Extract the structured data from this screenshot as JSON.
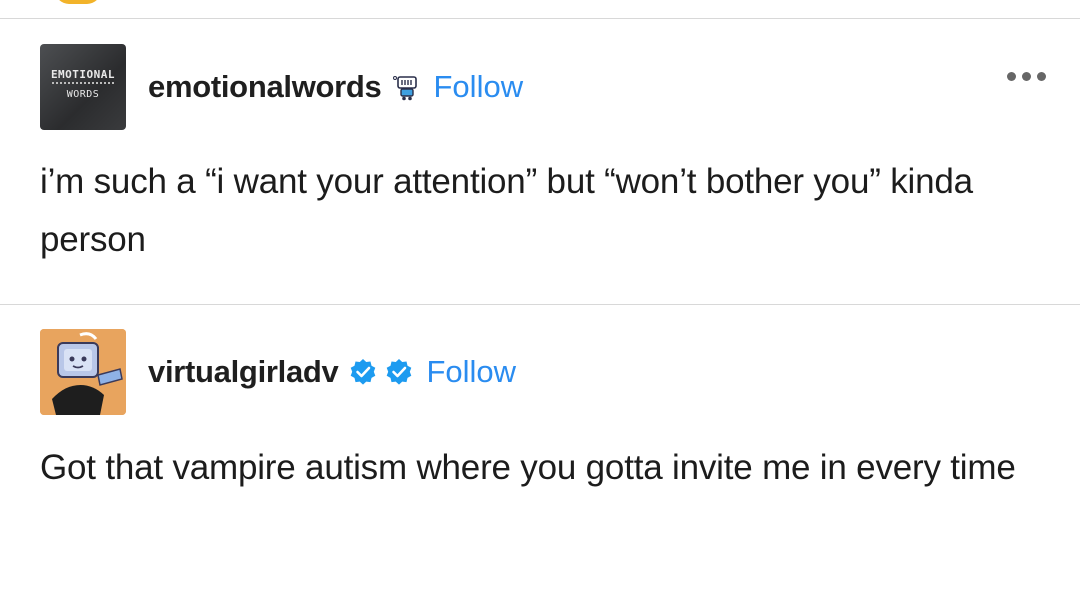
{
  "posts": [
    {
      "avatar": {
        "line1": "EMOTIONAL",
        "line2": "WORDS"
      },
      "username": "emotionalwords",
      "follow_label": "Follow",
      "body": "i’m such a “i want your attention” but “won’t bother you” kinda person"
    },
    {
      "username": "virtualgirladv",
      "follow_label": "Follow",
      "body": "Got that vampire autism where you gotta invite me in every time"
    }
  ],
  "icons": {
    "more": "more-options-icon",
    "verified": "verified-badge-icon",
    "robot_badge": "robot-badge-icon"
  },
  "colors": {
    "follow": "#2a8cf0",
    "verified": "#1d9bf0",
    "text": "#1c1c1c",
    "divider": "#d8d8d8"
  }
}
